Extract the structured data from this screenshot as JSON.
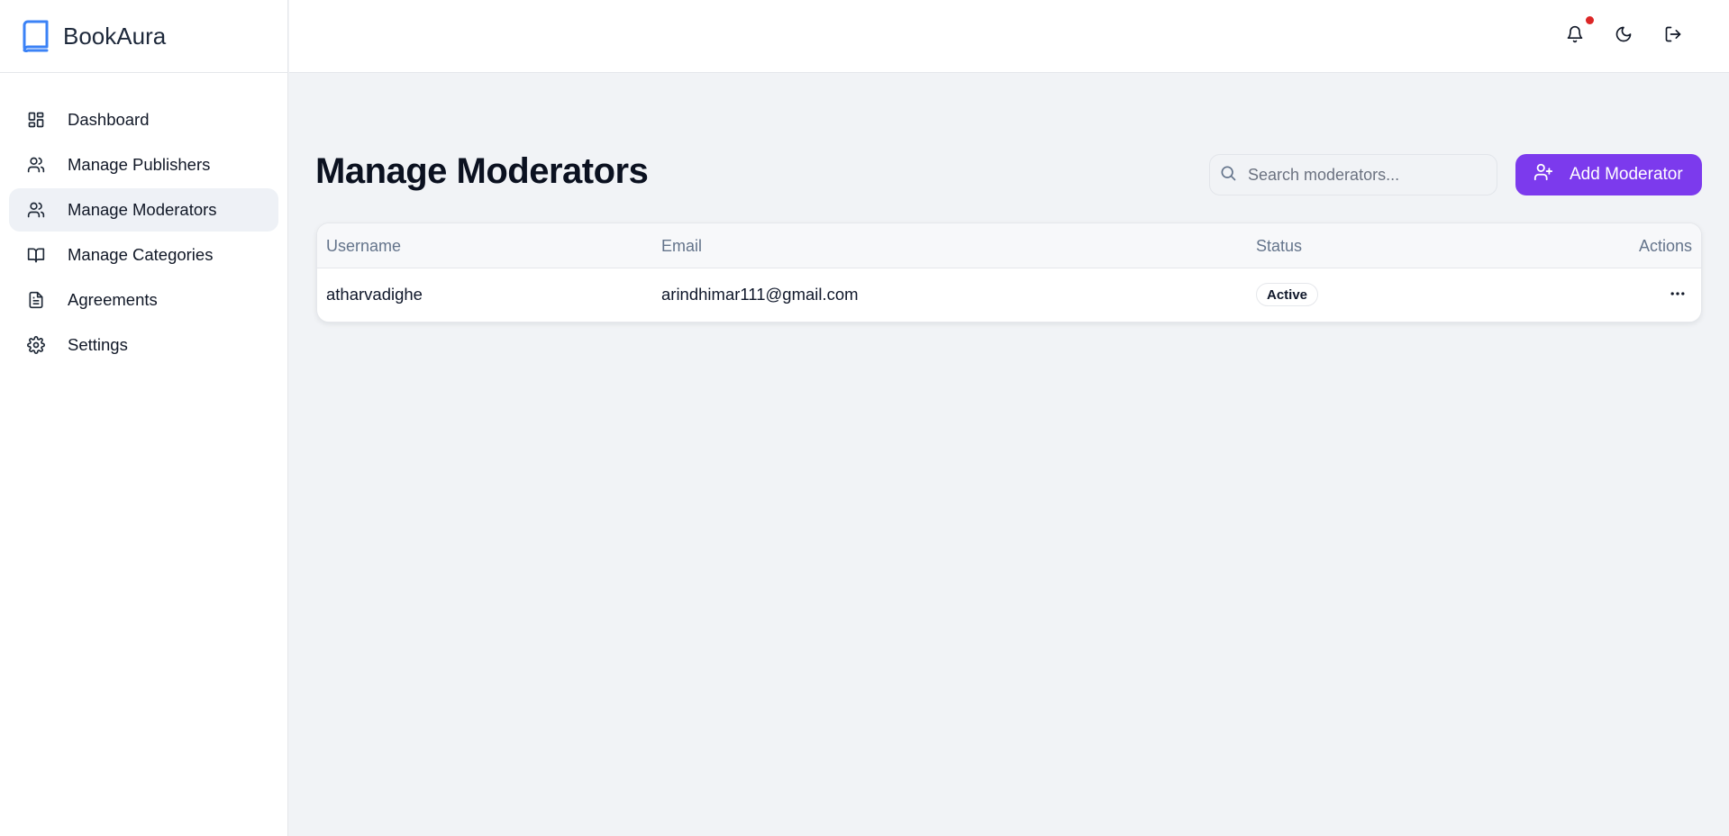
{
  "brand": {
    "name": "BookAura",
    "icon": "book-icon"
  },
  "sidebar": {
    "items": [
      {
        "label": "Dashboard",
        "icon": "dashboard-icon"
      },
      {
        "label": "Manage Publishers",
        "icon": "users-icon"
      },
      {
        "label": "Manage Moderators",
        "icon": "users-icon",
        "active": true
      },
      {
        "label": "Manage Categories",
        "icon": "open-book-icon"
      },
      {
        "label": "Agreements",
        "icon": "document-icon"
      },
      {
        "label": "Settings",
        "icon": "gear-icon"
      }
    ]
  },
  "topbar": {
    "icons": [
      "bell-icon",
      "moon-icon",
      "logout-icon"
    ],
    "notification_dot_color": "#dc2626"
  },
  "main": {
    "title": "Manage Moderators",
    "search": {
      "placeholder": "Search moderators..."
    },
    "add_button": {
      "label": "Add Moderator",
      "color": "#7c3aed"
    },
    "table": {
      "columns": [
        "Username",
        "Email",
        "Status",
        "Actions"
      ],
      "rows": [
        {
          "username": "atharvadighe",
          "email": "arindhimar111@gmail.com",
          "status": "Active"
        }
      ]
    }
  }
}
